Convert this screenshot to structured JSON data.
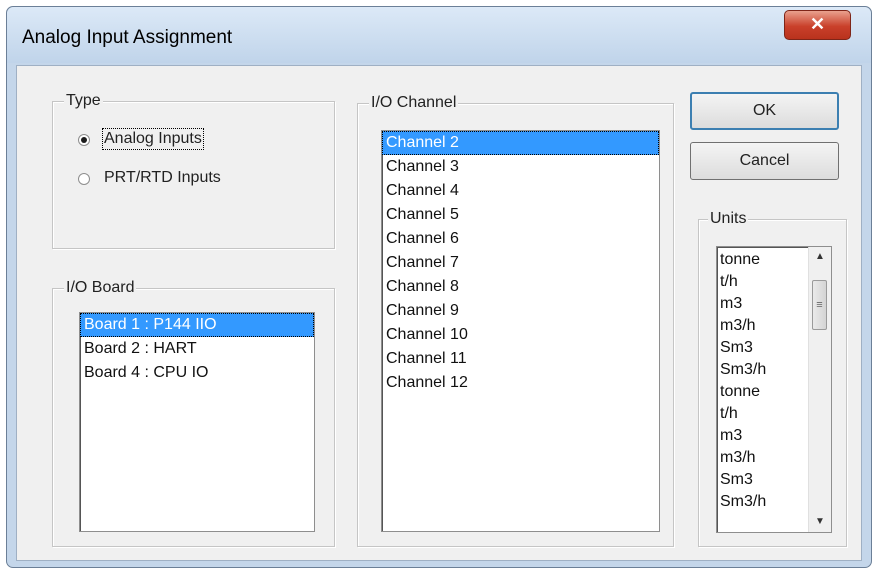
{
  "window": {
    "title": "Analog Input Assignment",
    "close_symbol": "✕"
  },
  "type_group": {
    "label": "Type",
    "options": [
      {
        "label": "Analog Inputs",
        "checked": true
      },
      {
        "label": "PRT/RTD Inputs",
        "checked": false
      }
    ]
  },
  "io_board": {
    "label": "I/O Board",
    "items": [
      "Board 1 : P144 IIO",
      "Board 2 : HART",
      "Board 4 : CPU IO"
    ],
    "selected_index": 0
  },
  "io_channel": {
    "label": "I/O Channel",
    "items": [
      "Channel 2",
      "Channel 3",
      "Channel 4",
      "Channel 5",
      "Channel 6",
      "Channel 7",
      "Channel 8",
      "Channel 9",
      "Channel 10",
      "Channel 11",
      "Channel 12"
    ],
    "selected_index": 0
  },
  "buttons": {
    "ok": "OK",
    "cancel": "Cancel"
  },
  "units": {
    "label": "Units",
    "items": [
      "tonne",
      "t/h",
      "m3",
      "m3/h",
      "Sm3",
      "Sm3/h",
      "tonne",
      "t/h",
      "m3",
      "m3/h",
      "Sm3",
      "Sm3/h"
    ]
  }
}
